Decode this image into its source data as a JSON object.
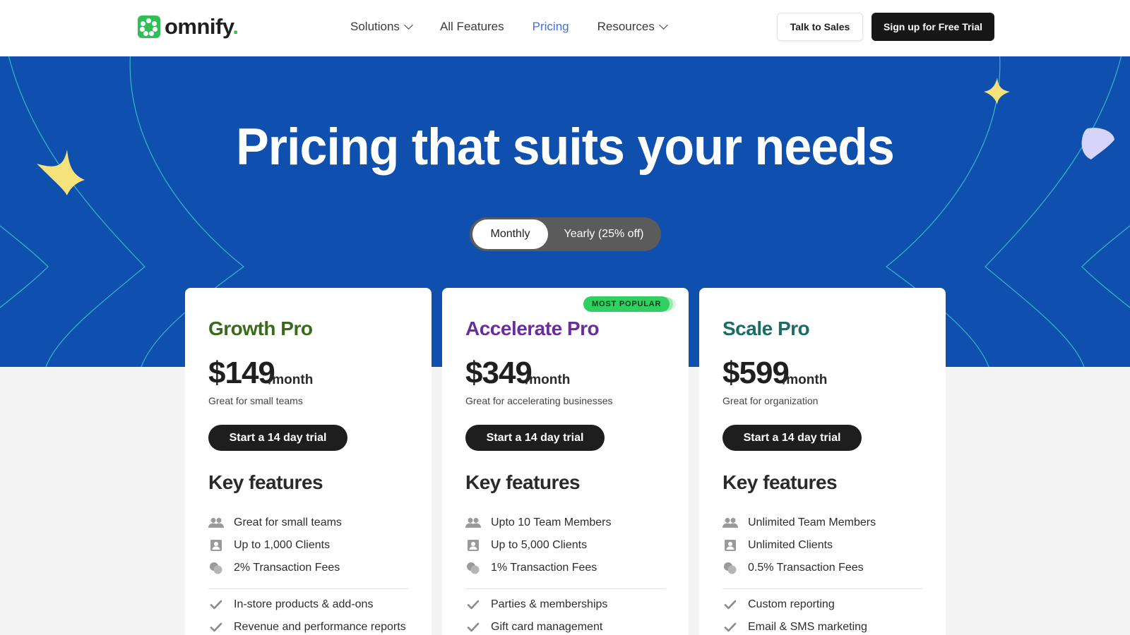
{
  "header": {
    "logo_text": "omnify",
    "nav": [
      {
        "label": "Solutions",
        "has_dropdown": true,
        "active": false
      },
      {
        "label": "All Features",
        "has_dropdown": false,
        "active": false
      },
      {
        "label": "Pricing",
        "has_dropdown": false,
        "active": true
      },
      {
        "label": "Resources",
        "has_dropdown": true,
        "active": false
      }
    ],
    "talk_to_sales": "Talk to Sales",
    "signup": "Sign up for Free Trial"
  },
  "hero": {
    "title": "Pricing that suits your needs",
    "billing_toggle": {
      "options": [
        "Monthly",
        "Yearly (25% off)"
      ],
      "selected": "Monthly"
    }
  },
  "plans": [
    {
      "name": "Growth Pro",
      "name_color": "#3b6b1a",
      "price": "$149",
      "period": "/month",
      "tagline": "Great for small teams",
      "cta": "Start a 14 day trial",
      "features_heading": "Key features",
      "limits": [
        "Great for small teams",
        "Up to 1,000 Clients",
        "2% Transaction Fees"
      ],
      "features": [
        "In-store products & add-ons",
        "Revenue and performance reports"
      ]
    },
    {
      "name": "Accelerate Pro",
      "name_color": "#6a2e9c",
      "badge": "MOST POPULAR",
      "price": "$349",
      "period": "/month",
      "tagline": "Great for accelerating businesses",
      "cta": "Start a 14 day trial",
      "features_heading": "Key features",
      "limits": [
        "Upto 10 Team Members",
        "Up to 5,000 Clients",
        "1% Transaction Fees"
      ],
      "features": [
        "Parties & memberships",
        "Gift card management"
      ]
    },
    {
      "name": "Scale Pro",
      "name_color": "#1b6b66",
      "price": "$599",
      "period": "/month",
      "tagline": "Great for organization",
      "cta": "Start a 14 day trial",
      "features_heading": "Key features",
      "limits": [
        "Unlimited Team Members",
        "Unlimited Clients",
        "0.5% Transaction Fees"
      ],
      "features": [
        "Custom reporting",
        "Email & SMS marketing"
      ]
    }
  ],
  "icons": {
    "limit_icons": [
      "team-members-icon",
      "clients-icon",
      "transaction-fees-icon"
    ],
    "feature_icon": "checkmark-icon"
  },
  "colors": {
    "hero_bg": "#0f4fad",
    "brand_green": "#2fbf57",
    "cta_dark": "#1e1e1e",
    "accent_link": "#4a6fd6",
    "star_yellow": "#f6e27a"
  }
}
